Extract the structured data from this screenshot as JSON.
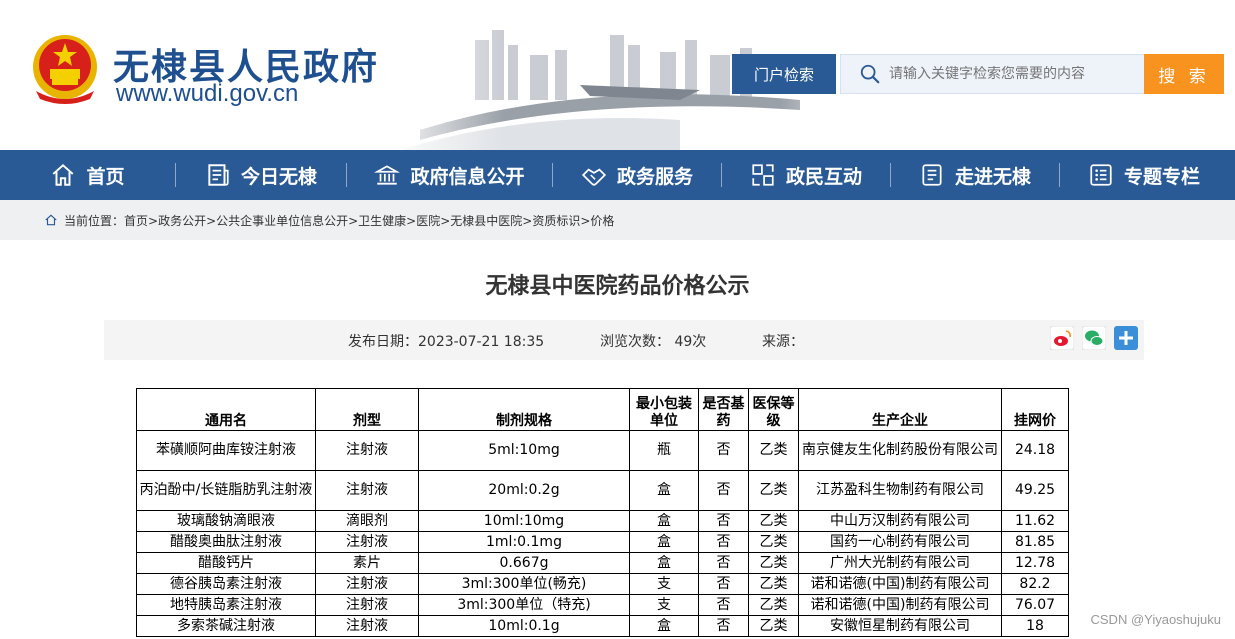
{
  "site": {
    "title": "无棣县人民政府",
    "url": "www.wudi.gov.cn"
  },
  "search": {
    "label": "门户检索",
    "placeholder": "请输入关键字检索您需要的内容",
    "button": "搜 索"
  },
  "nav": [
    {
      "label": "首页",
      "icon": "home-icon"
    },
    {
      "label": "今日无棣",
      "icon": "newspaper-icon"
    },
    {
      "label": "政府信息公开",
      "icon": "government-building-icon"
    },
    {
      "label": "政务服务",
      "icon": "handshake-icon"
    },
    {
      "label": "政民互动",
      "icon": "interaction-icon"
    },
    {
      "label": "走进无棣",
      "icon": "document-icon"
    },
    {
      "label": "专题专栏",
      "icon": "list-icon"
    }
  ],
  "breadcrumb": {
    "prefix": "当前位置：",
    "path": "首页>政务公开>公共企事业单位信息公开>卫生健康>医院>无棣县中医院>资质标识>价格"
  },
  "article": {
    "title": "无棣县中医院药品价格公示",
    "date_label": "发布日期：2023-07-21 18:35",
    "views_label": "浏览次数：  49次",
    "source_label": "来源："
  },
  "table": {
    "headers": [
      "通用名",
      "剂型",
      "制剂规格",
      "最小包装单位",
      "是否基药",
      "医保等级",
      "生产企业",
      "挂网价"
    ],
    "rows": [
      [
        "苯磺顺阿曲库铵注射液",
        "注射液",
        "5ml:10mg",
        "瓶",
        "否",
        "乙类",
        "南京健友生化制药股份有限公司",
        "24.18"
      ],
      [
        "丙泊酚中/长链脂肪乳注射液",
        "注射液",
        "20ml:0.2g",
        "盒",
        "否",
        "乙类",
        "江苏盈科生物制药有限公司",
        "49.25"
      ],
      [
        "玻璃酸钠滴眼液",
        "滴眼剂",
        "10ml:10mg",
        "盒",
        "否",
        "乙类",
        "中山万汉制药有限公司",
        "11.62"
      ],
      [
        "醋酸奥曲肽注射液",
        "注射液",
        "1ml:0.1mg",
        "盒",
        "否",
        "乙类",
        "国药一心制药有限公司",
        "81.85"
      ],
      [
        "醋酸钙片",
        "素片",
        "0.667g",
        "盒",
        "否",
        "乙类",
        "广州大光制药有限公司",
        "12.78"
      ],
      [
        "德谷胰岛素注射液",
        "注射液",
        "3ml:300单位(畅充)",
        "支",
        "否",
        "乙类",
        "诺和诺德(中国)制药有限公司",
        "82.2"
      ],
      [
        "地特胰岛素注射液",
        "注射液",
        "3ml:300单位（特充)",
        "支",
        "否",
        "乙类",
        "诺和诺德(中国)制药有限公司",
        "76.07"
      ],
      [
        "多索茶碱注射液",
        "注射液",
        "10ml:0.1g",
        "盒",
        "否",
        "乙类",
        "安徽恒星制药有限公司",
        "18"
      ]
    ]
  },
  "watermark": "CSDN @Yiyaoshujuku",
  "colors": {
    "primary": "#2a5a96",
    "accent": "#f7931e",
    "title_blue": "#1e4f8f"
  }
}
